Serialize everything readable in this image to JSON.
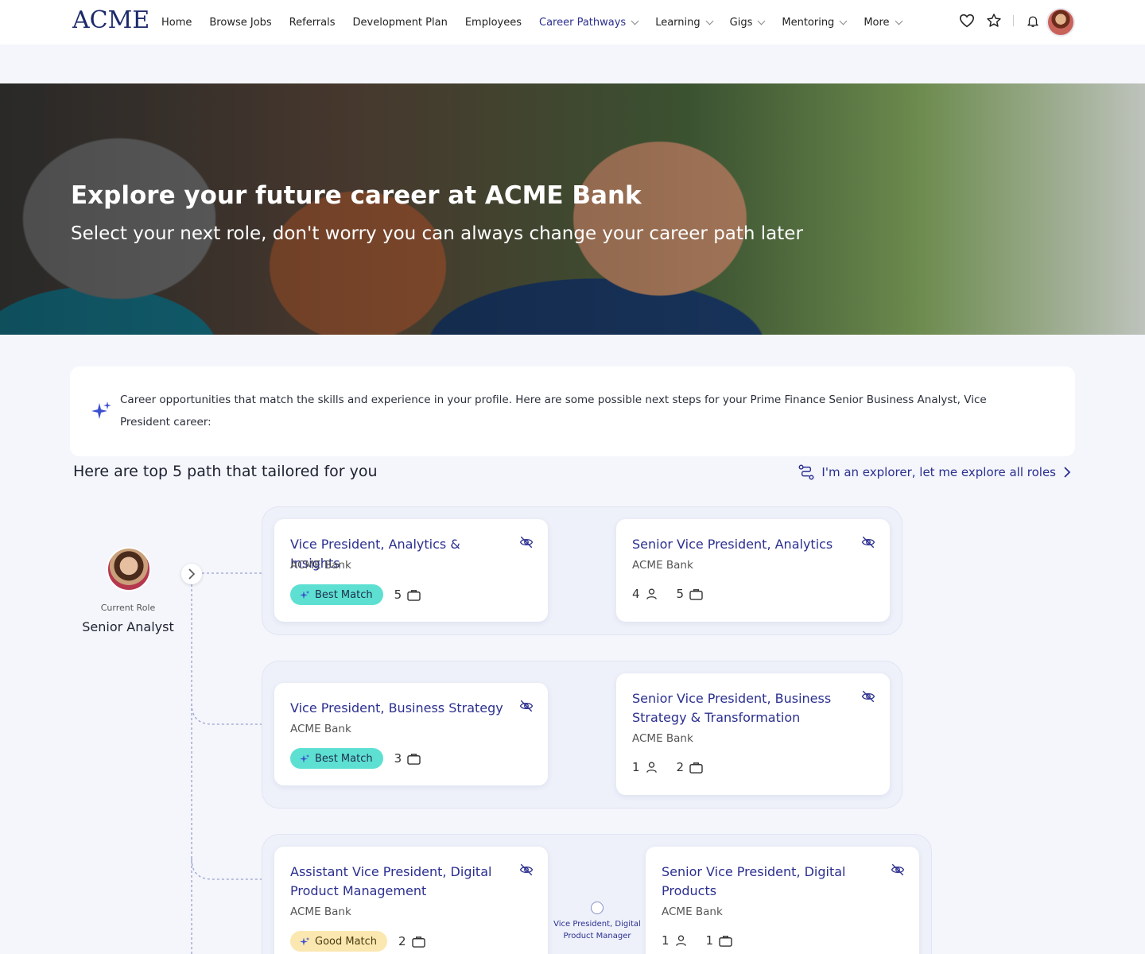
{
  "nav": {
    "logo": "ACME",
    "links": [
      {
        "label": "Home"
      },
      {
        "label": "Browse Jobs"
      },
      {
        "label": "Referrals"
      },
      {
        "label": "Development Plan"
      },
      {
        "label": "Employees"
      },
      {
        "label": "Career Pathways",
        "active": true,
        "dropdown": true
      },
      {
        "label": "Learning",
        "dropdown": true
      },
      {
        "label": "Gigs",
        "dropdown": true
      },
      {
        "label": "Mentoring",
        "dropdown": true
      },
      {
        "label": "More",
        "dropdown": true
      }
    ],
    "icons": [
      "heart-icon",
      "star-icon",
      "bell-icon"
    ]
  },
  "hero": {
    "title": "Explore your future career at ACME Bank",
    "subtitle": "Select your next role, don't worry you can always change your career path later"
  },
  "info": {
    "text": "Career opportunities that match the skills and experience in your profile. Here are some possible next steps for your Prime Finance Senior Business Analyst, Vice President career:"
  },
  "section": {
    "title": "Here are top 5 path that tailored for you",
    "explore_label": "I'm an explorer, let me explore all roles"
  },
  "current": {
    "label": "Current Role",
    "role": "Senior Analyst"
  },
  "paths": [
    {
      "first": {
        "title": "Vice President, Analytics & Insights",
        "company": "ACME Bank",
        "match": "Best Match",
        "jobs": "5"
      },
      "second": {
        "title": "Senior Vice President, Analytics",
        "company": "ACME Bank",
        "people": "4",
        "jobs": "5"
      }
    },
    {
      "first": {
        "title": "Vice President, Business Strategy",
        "company": "ACME Bank",
        "match": "Best Match",
        "jobs": "3"
      },
      "second": {
        "title": "Senior Vice President, Business Strategy & Transformation",
        "company": "ACME Bank",
        "people": "1",
        "jobs": "2"
      }
    },
    {
      "first": {
        "title": "Assistant Vice President, Digital Product Management",
        "company": "ACME Bank",
        "match": "Good Match",
        "jobs": "2"
      },
      "middle": {
        "label": "Vice President, Digital Product Manager"
      },
      "second": {
        "title": "Senior Vice President, Digital Products",
        "company": "ACME Bank",
        "people": "1",
        "jobs": "1"
      }
    }
  ],
  "colors": {
    "accent": "#2b2f8f",
    "best_match": "#5de0d2",
    "good_match": "#fbe8b0"
  }
}
